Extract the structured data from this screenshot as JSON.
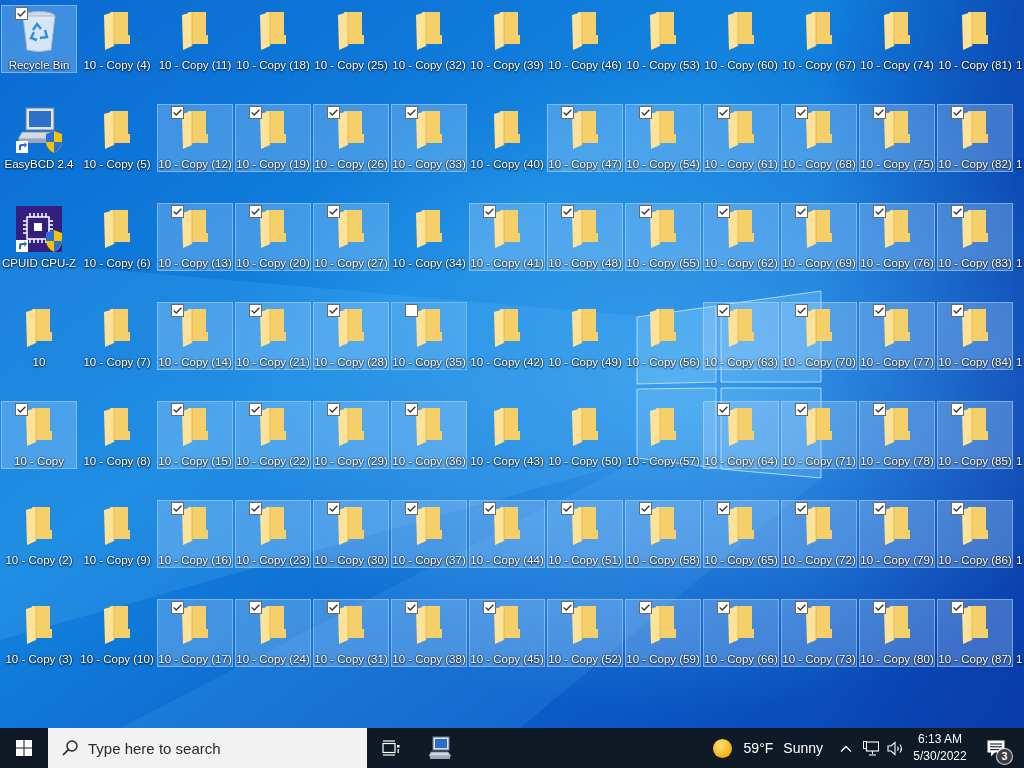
{
  "desktop": {
    "columns": [
      {
        "items": [
          {
            "kind": "recycle",
            "label": "Recycle Bin",
            "selected": true,
            "hovered": false
          },
          {
            "kind": "computer",
            "label": "EasyBCD 2.4",
            "selected": false,
            "hovered": false
          },
          {
            "kind": "chip",
            "label": "CPUID CPU-Z",
            "selected": false,
            "hovered": false
          },
          {
            "kind": "folder",
            "label": "10",
            "selected": false,
            "hovered": false
          },
          {
            "kind": "folder",
            "label": "10 - Copy",
            "selected": true,
            "hovered": false
          },
          {
            "kind": "folder",
            "label": "10 - Copy (2)",
            "selected": false,
            "hovered": false
          },
          {
            "kind": "folder",
            "label": "10 - Copy (3)",
            "selected": false,
            "hovered": false
          }
        ]
      },
      {
        "items": [
          {
            "kind": "folder",
            "label": "10 - Copy (4)",
            "selected": false,
            "hovered": false
          },
          {
            "kind": "folder",
            "label": "10 - Copy (5)",
            "selected": false,
            "hovered": false
          },
          {
            "kind": "folder",
            "label": "10 - Copy (6)",
            "selected": false,
            "hovered": false
          },
          {
            "kind": "folder",
            "label": "10 - Copy (7)",
            "selected": false,
            "hovered": false
          },
          {
            "kind": "folder",
            "label": "10 - Copy (8)",
            "selected": false,
            "hovered": false
          },
          {
            "kind": "folder",
            "label": "10 - Copy (9)",
            "selected": false,
            "hovered": false
          },
          {
            "kind": "folder",
            "label": "10 - Copy (10)",
            "selected": false,
            "hovered": false
          }
        ]
      },
      {
        "items": [
          {
            "kind": "folder",
            "label": "10 - Copy (11)",
            "selected": false,
            "hovered": false
          },
          {
            "kind": "folder",
            "label": "10 - Copy (12)",
            "selected": true,
            "hovered": false
          },
          {
            "kind": "folder",
            "label": "10 - Copy (13)",
            "selected": true,
            "hovered": false
          },
          {
            "kind": "folder",
            "label": "10 - Copy (14)",
            "selected": true,
            "hovered": false
          },
          {
            "kind": "folder",
            "label": "10 - Copy (15)",
            "selected": true,
            "hovered": false
          },
          {
            "kind": "folder",
            "label": "10 - Copy (16)",
            "selected": true,
            "hovered": false
          },
          {
            "kind": "folder",
            "label": "10 - Copy (17)",
            "selected": true,
            "hovered": false
          }
        ]
      },
      {
        "items": [
          {
            "kind": "folder",
            "label": "10 - Copy (18)",
            "selected": false,
            "hovered": false
          },
          {
            "kind": "folder",
            "label": "10 - Copy (19)",
            "selected": true,
            "hovered": false
          },
          {
            "kind": "folder",
            "label": "10 - Copy (20)",
            "selected": true,
            "hovered": false
          },
          {
            "kind": "folder",
            "label": "10 - Copy (21)",
            "selected": true,
            "hovered": false
          },
          {
            "kind": "folder",
            "label": "10 - Copy (22)",
            "selected": true,
            "hovered": false
          },
          {
            "kind": "folder",
            "label": "10 - Copy (23)",
            "selected": true,
            "hovered": false
          },
          {
            "kind": "folder",
            "label": "10 - Copy (24)",
            "selected": true,
            "hovered": false
          }
        ]
      },
      {
        "items": [
          {
            "kind": "folder",
            "label": "10 - Copy (25)",
            "selected": false,
            "hovered": false
          },
          {
            "kind": "folder",
            "label": "10 - Copy (26)",
            "selected": true,
            "hovered": false
          },
          {
            "kind": "folder",
            "label": "10 - Copy (27)",
            "selected": true,
            "hovered": false
          },
          {
            "kind": "folder",
            "label": "10 - Copy (28)",
            "selected": true,
            "hovered": false
          },
          {
            "kind": "folder",
            "label": "10 - Copy (29)",
            "selected": true,
            "hovered": false
          },
          {
            "kind": "folder",
            "label": "10 - Copy (30)",
            "selected": true,
            "hovered": false
          },
          {
            "kind": "folder",
            "label": "10 - Copy (31)",
            "selected": true,
            "hovered": false
          }
        ]
      },
      {
        "items": [
          {
            "kind": "folder",
            "label": "10 - Copy (32)",
            "selected": false,
            "hovered": false
          },
          {
            "kind": "folder",
            "label": "10 - Copy (33)",
            "selected": true,
            "hovered": false
          },
          {
            "kind": "folder",
            "label": "10 - Copy (34)",
            "selected": false,
            "hovered": false
          },
          {
            "kind": "folder",
            "label": "10 - Copy (35)",
            "selected": false,
            "hovered": true
          },
          {
            "kind": "folder",
            "label": "10 - Copy (36)",
            "selected": true,
            "hovered": false
          },
          {
            "kind": "folder",
            "label": "10 - Copy (37)",
            "selected": true,
            "hovered": false
          },
          {
            "kind": "folder",
            "label": "10 - Copy (38)",
            "selected": true,
            "hovered": false
          }
        ]
      },
      {
        "items": [
          {
            "kind": "folder",
            "label": "10 - Copy (39)",
            "selected": false,
            "hovered": false
          },
          {
            "kind": "folder",
            "label": "10 - Copy (40)",
            "selected": false,
            "hovered": false
          },
          {
            "kind": "folder",
            "label": "10 - Copy (41)",
            "selected": true,
            "hovered": false
          },
          {
            "kind": "folder",
            "label": "10 - Copy (42)",
            "selected": false,
            "hovered": false
          },
          {
            "kind": "folder",
            "label": "10 - Copy (43)",
            "selected": false,
            "hovered": false
          },
          {
            "kind": "folder",
            "label": "10 - Copy (44)",
            "selected": true,
            "hovered": false
          },
          {
            "kind": "folder",
            "label": "10 - Copy (45)",
            "selected": true,
            "hovered": false
          }
        ]
      },
      {
        "items": [
          {
            "kind": "folder",
            "label": "10 - Copy (46)",
            "selected": false,
            "hovered": false
          },
          {
            "kind": "folder",
            "label": "10 - Copy (47)",
            "selected": true,
            "hovered": false
          },
          {
            "kind": "folder",
            "label": "10 - Copy (48)",
            "selected": true,
            "hovered": false
          },
          {
            "kind": "folder",
            "label": "10 - Copy (49)",
            "selected": false,
            "hovered": false
          },
          {
            "kind": "folder",
            "label": "10 - Copy (50)",
            "selected": false,
            "hovered": false
          },
          {
            "kind": "folder",
            "label": "10 - Copy (51)",
            "selected": true,
            "hovered": false
          },
          {
            "kind": "folder",
            "label": "10 - Copy (52)",
            "selected": true,
            "hovered": false
          }
        ]
      },
      {
        "items": [
          {
            "kind": "folder",
            "label": "10 - Copy (53)",
            "selected": false,
            "hovered": false
          },
          {
            "kind": "folder",
            "label": "10 - Copy (54)",
            "selected": true,
            "hovered": false
          },
          {
            "kind": "folder",
            "label": "10 - Copy (55)",
            "selected": true,
            "hovered": false
          },
          {
            "kind": "folder",
            "label": "10 - Copy (56)",
            "selected": false,
            "hovered": false
          },
          {
            "kind": "folder",
            "label": "10 - Copy (57)",
            "selected": false,
            "hovered": false
          },
          {
            "kind": "folder",
            "label": "10 - Copy (58)",
            "selected": true,
            "hovered": false
          },
          {
            "kind": "folder",
            "label": "10 - Copy (59)",
            "selected": true,
            "hovered": false
          }
        ]
      },
      {
        "items": [
          {
            "kind": "folder",
            "label": "10 - Copy (60)",
            "selected": false,
            "hovered": false
          },
          {
            "kind": "folder",
            "label": "10 - Copy (61)",
            "selected": true,
            "hovered": false
          },
          {
            "kind": "folder",
            "label": "10 - Copy (62)",
            "selected": true,
            "hovered": false
          },
          {
            "kind": "folder",
            "label": "10 - Copy (63)",
            "selected": true,
            "hovered": false
          },
          {
            "kind": "folder",
            "label": "10 - Copy (64)",
            "selected": true,
            "hovered": false
          },
          {
            "kind": "folder",
            "label": "10 - Copy (65)",
            "selected": true,
            "hovered": false
          },
          {
            "kind": "folder",
            "label": "10 - Copy (66)",
            "selected": true,
            "hovered": false
          }
        ]
      },
      {
        "items": [
          {
            "kind": "folder",
            "label": "10 - Copy (67)",
            "selected": false,
            "hovered": false
          },
          {
            "kind": "folder",
            "label": "10 - Copy (68)",
            "selected": true,
            "hovered": false
          },
          {
            "kind": "folder",
            "label": "10 - Copy (69)",
            "selected": true,
            "hovered": false
          },
          {
            "kind": "folder",
            "label": "10 - Copy (70)",
            "selected": true,
            "hovered": false
          },
          {
            "kind": "folder",
            "label": "10 - Copy (71)",
            "selected": true,
            "hovered": false
          },
          {
            "kind": "folder",
            "label": "10 - Copy (72)",
            "selected": true,
            "hovered": false
          },
          {
            "kind": "folder",
            "label": "10 - Copy (73)",
            "selected": true,
            "hovered": false
          }
        ]
      },
      {
        "items": [
          {
            "kind": "folder",
            "label": "10 - Copy (74)",
            "selected": false,
            "hovered": false
          },
          {
            "kind": "folder",
            "label": "10 - Copy (75)",
            "selected": true,
            "hovered": false
          },
          {
            "kind": "folder",
            "label": "10 - Copy (76)",
            "selected": true,
            "hovered": false
          },
          {
            "kind": "folder",
            "label": "10 - Copy (77)",
            "selected": true,
            "hovered": false
          },
          {
            "kind": "folder",
            "label": "10 - Copy (78)",
            "selected": true,
            "hovered": false
          },
          {
            "kind": "folder",
            "label": "10 - Copy (79)",
            "selected": true,
            "hovered": false
          },
          {
            "kind": "folder",
            "label": "10 - Copy (80)",
            "selected": true,
            "hovered": false
          }
        ]
      },
      {
        "items": [
          {
            "kind": "folder",
            "label": "10 - Copy (81)",
            "selected": false,
            "hovered": false
          },
          {
            "kind": "folder",
            "label": "10 - Copy (82)",
            "selected": true,
            "hovered": false
          },
          {
            "kind": "folder",
            "label": "10 - Copy (83)",
            "selected": true,
            "hovered": false
          },
          {
            "kind": "folder",
            "label": "10 - Copy (84)",
            "selected": true,
            "hovered": false
          },
          {
            "kind": "folder",
            "label": "10 - Copy (85)",
            "selected": true,
            "hovered": false
          },
          {
            "kind": "folder",
            "label": "10 - Copy (86)",
            "selected": true,
            "hovered": false
          },
          {
            "kind": "folder",
            "label": "10 - Copy (87)",
            "selected": true,
            "hovered": false
          }
        ]
      }
    ],
    "partial_column": [
      {
        "label": "1"
      },
      {
        "label": "1"
      },
      {
        "label": "1"
      },
      {
        "label": "1"
      },
      {
        "label": "1"
      },
      {
        "label": "1"
      },
      {
        "label": "1"
      }
    ]
  },
  "taskbar": {
    "search": {
      "placeholder": "Type here to search"
    },
    "weather": {
      "temperature": "59°F",
      "condition": "Sunny"
    },
    "clock": {
      "time": "6:13 AM",
      "date": "5/30/2022"
    },
    "notifications": {
      "count": "3"
    }
  }
}
